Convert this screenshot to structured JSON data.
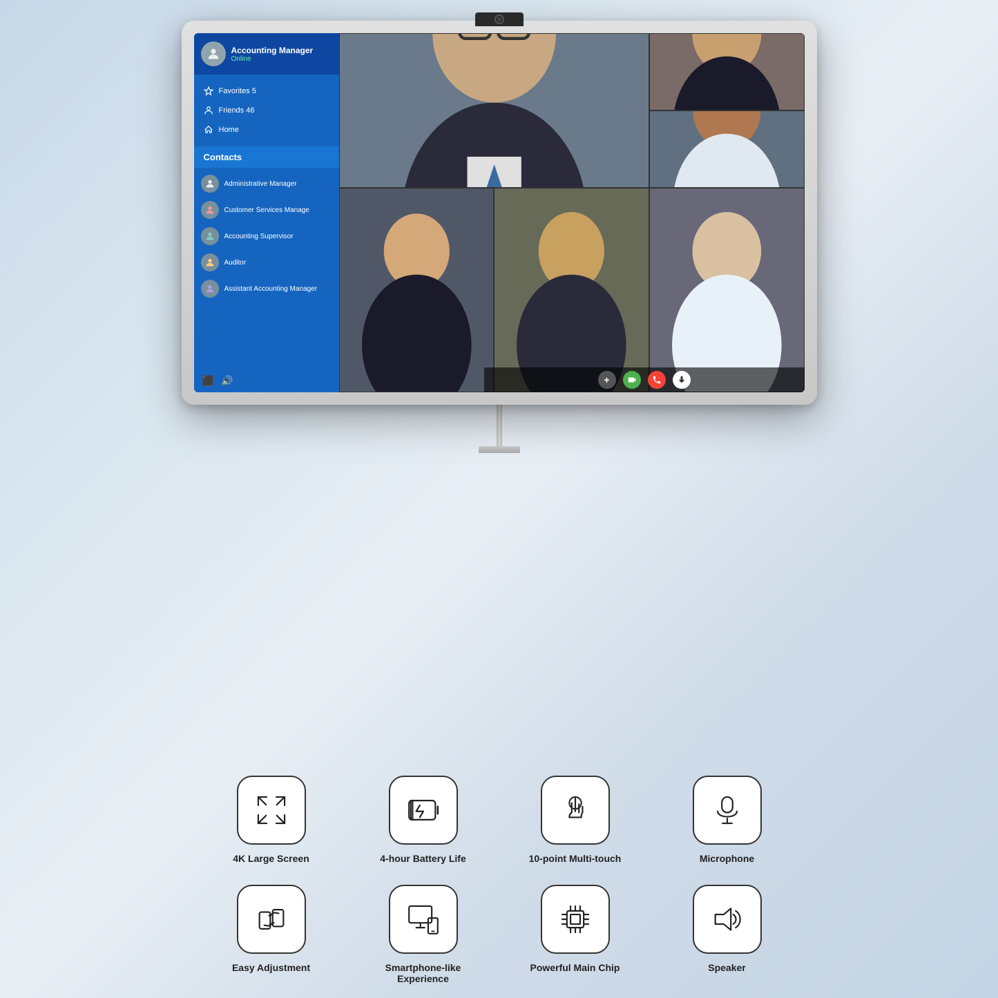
{
  "monitor": {
    "webcam_label": "webcam"
  },
  "sidebar": {
    "profile": {
      "name": "Accounting  Manager",
      "status": "Online"
    },
    "nav_items": [
      {
        "icon": "star",
        "label": "Favorites 5"
      },
      {
        "icon": "person",
        "label": "Friends 46"
      },
      {
        "icon": "home",
        "label": "Home"
      }
    ],
    "contacts_header": "Contacts",
    "contacts": [
      {
        "name": "Administrative Manager"
      },
      {
        "name": "Customer Services Manage"
      },
      {
        "name": "Accounting Supervisor"
      },
      {
        "name": "Auditor"
      },
      {
        "name": "Assistant Accounting Manager"
      }
    ]
  },
  "call_controls": {
    "add": "+",
    "video": "▶",
    "end": "✕",
    "mic": "🎤"
  },
  "features": {
    "row1": [
      {
        "id": "4k-screen",
        "label": "4K Large Screen",
        "icon": "expand"
      },
      {
        "id": "battery",
        "label": "4-hour Battery Life",
        "icon": "battery"
      },
      {
        "id": "multitouch",
        "label": "10-point Multi-touch",
        "icon": "touch"
      },
      {
        "id": "microphone",
        "label": "Microphone",
        "icon": "mic"
      }
    ],
    "row2": [
      {
        "id": "adjustment",
        "label": "Easy Adjustment",
        "icon": "rotate"
      },
      {
        "id": "smartphone",
        "label": "Smartphone-like Experience",
        "icon": "devices"
      },
      {
        "id": "chip",
        "label": "Powerful Main Chip",
        "icon": "chip"
      },
      {
        "id": "speaker",
        "label": "Speaker",
        "icon": "speaker"
      }
    ]
  }
}
